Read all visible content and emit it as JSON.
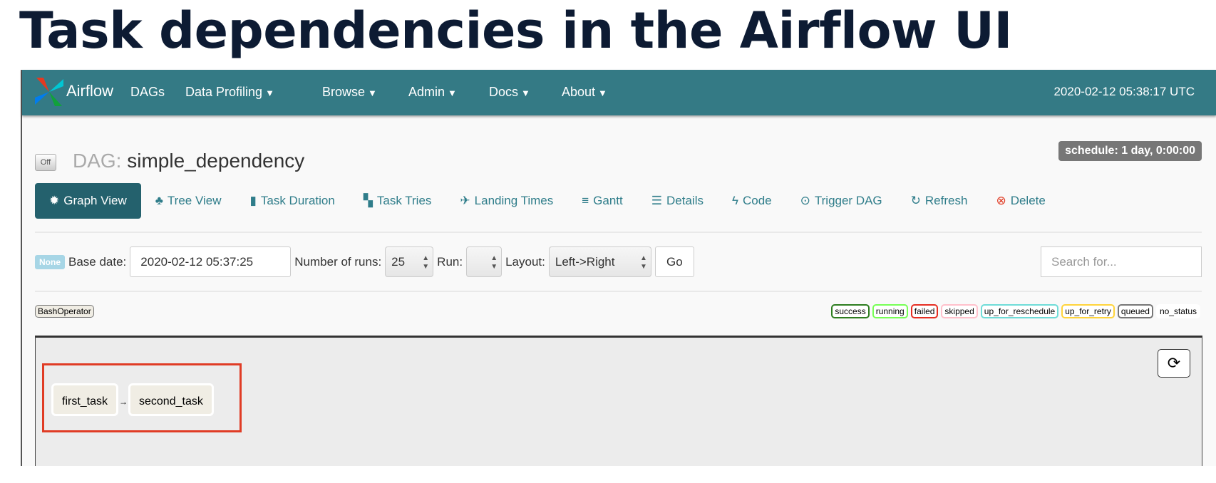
{
  "heading": "Task dependencies in the Airflow UI",
  "navbar": {
    "brand": "Airflow",
    "items": [
      "DAGs",
      "Data Profiling",
      "Browse",
      "Admin",
      "Docs",
      "About"
    ],
    "clock": "2020-02-12 05:38:17 UTC",
    "color": "#347a85"
  },
  "dag": {
    "toggle": "Off",
    "prefix": "DAG:",
    "name": "simple_dependency",
    "schedule": "schedule: 1 day, 0:00:00"
  },
  "tabs": [
    "Graph View",
    "Tree View",
    "Task Duration",
    "Task Tries",
    "Landing Times",
    "Gantt",
    "Details",
    "Code",
    "Trigger DAG",
    "Refresh",
    "Delete"
  ],
  "controls": {
    "state_badge": "None",
    "base_date_label": "Base date:",
    "base_date": "2020-02-12 05:37:25",
    "runs_label": "Number of runs:",
    "runs": "25",
    "run_label": "Run:",
    "run": "",
    "layout_label": "Layout:",
    "layout": "Left->Right",
    "go": "Go",
    "search_placeholder": "Search for..."
  },
  "operator": "BashOperator",
  "legend": [
    "success",
    "running",
    "failed",
    "skipped",
    "up_for_reschedule",
    "up_for_retry",
    "queued",
    "no_status"
  ],
  "legend_colors": [
    "#2d7d1f",
    "#77ff55",
    "#e62e22",
    "#ffc0cb",
    "#6fdcd8",
    "#ffd43b",
    "#777777",
    "#ffffff"
  ],
  "graph": {
    "nodes": [
      "first_task",
      "second_task"
    ],
    "edge_arrow": "→"
  }
}
